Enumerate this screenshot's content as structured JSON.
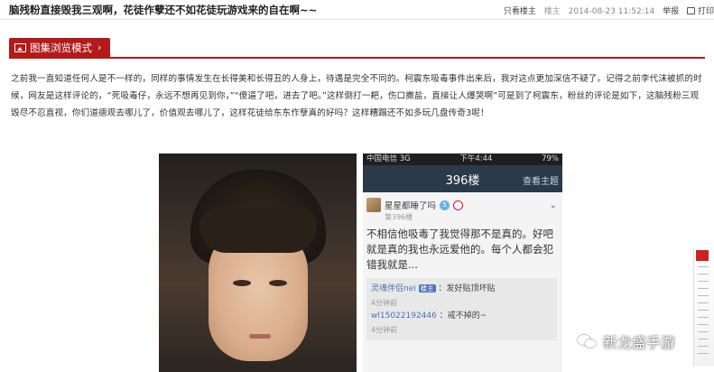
{
  "post": {
    "title": "脑残粉直接毁我三观啊，花徒作孽还不如花徒玩游戏来的自在啊~~",
    "meta": {
      "view_op": "只看楼主",
      "op_badge": "楼主",
      "time": "2014-08-23 11:52:14",
      "report": "举报",
      "print": "打印"
    }
  },
  "tagbar": {
    "gallery_label": "图集浏览模式"
  },
  "body": {
    "paragraph": "之前我一直知道任何人是不一样的，同样的事情发生在长得美和长得丑的人身上，待遇是完全不同的。柯震东吸毒事件出来后，我对这点更加深信不疑了。记得之前李代沫被抓的时候，网友是这样评论的，“死吸毒仔，永远不想再见到你，”“傻逼了吧，进去了吧。”这样倒打一耙，伤口撒盐，直接让人爆哭啊”可是到了柯震东，粉丝的评论是如下，这脑残粉三观毁尽不忍直视，你们道德观去哪儿了，价值观去哪儿了，这样花徒给东东作孽真的好吗？这样糟蹋还不如多玩几盘传奇3呢！"
  },
  "phone": {
    "status_left": "中国电信  3G",
    "status_time": "下午4:44",
    "status_right": "79%",
    "floor_title": "396楼",
    "floor_action": "查看主题",
    "username": "星星都睡了吗",
    "level": "5",
    "floor_sub": "第396楼",
    "content": "不相信他吸毒了我觉得那不是真的。好吧就是真的我也永远爱他的。每个人都会犯错我就是...",
    "reply1_user": "灵魂伴侣nei",
    "reply1_badge": "楼主",
    "reply1_text": "：发好贴顶坏贴",
    "reply1_ago": "4分钟前",
    "reply2_user": "wl15022192446",
    "reply2_text": "：戒不掉的~",
    "reply2_ago": "4分钟前"
  },
  "watermark": {
    "text": "新龙盛手游"
  },
  "colors": {
    "accent": "#b31a1a",
    "phone_header": "#2b3a48"
  }
}
